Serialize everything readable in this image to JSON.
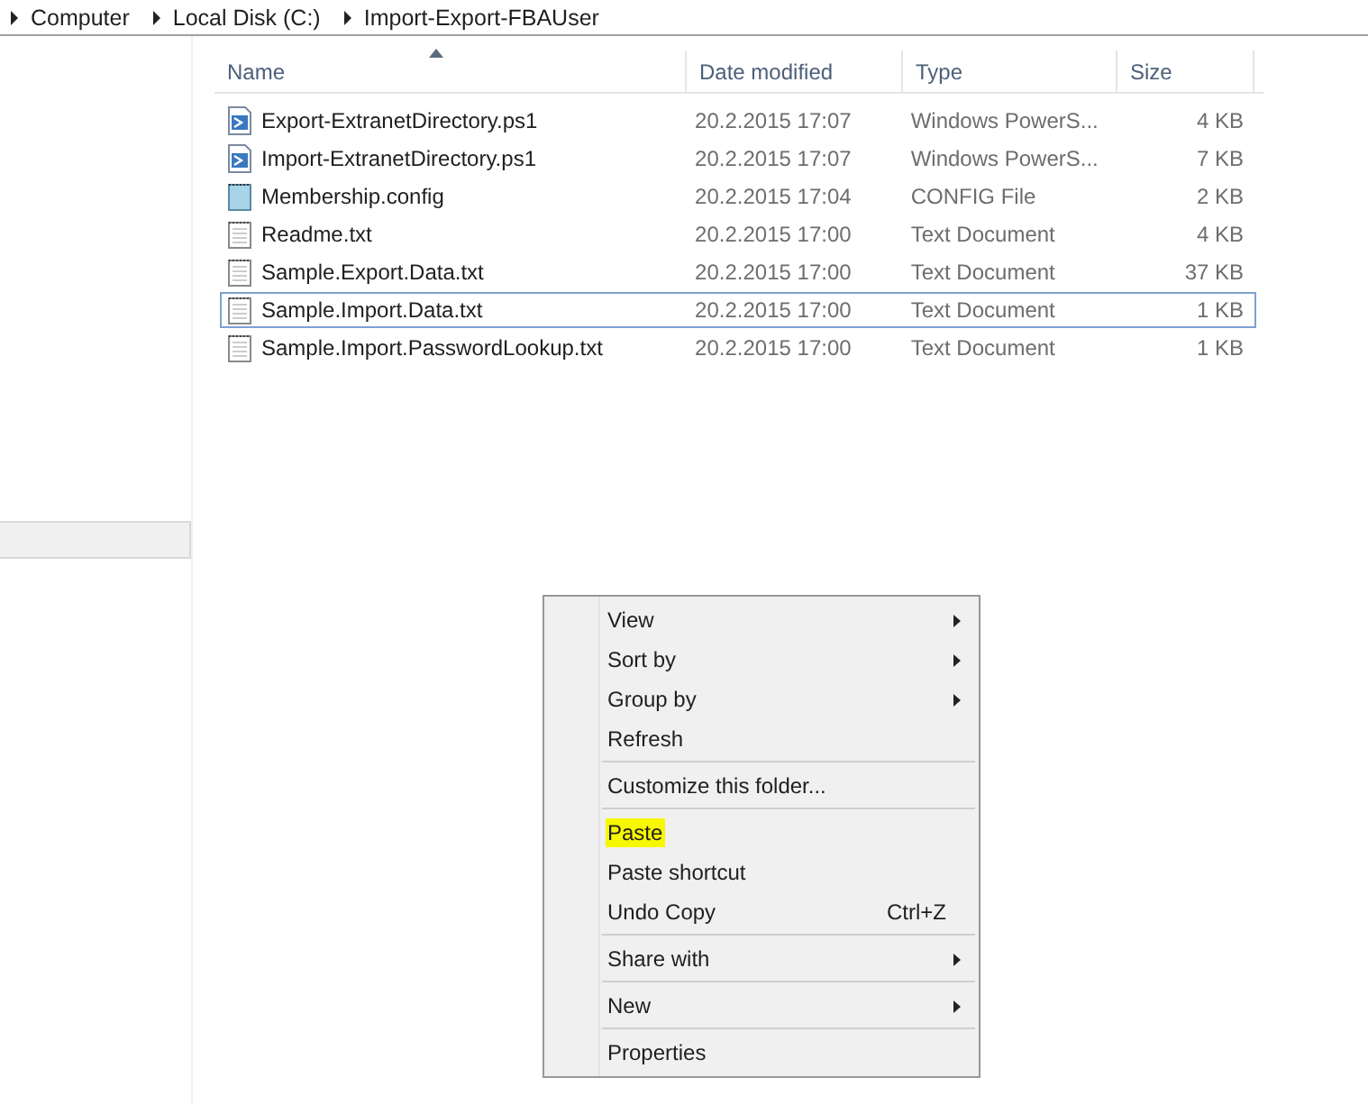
{
  "breadcrumb": [
    "Computer",
    "Local Disk (C:)",
    "Import-Export-FBAUser"
  ],
  "table": {
    "columns": [
      {
        "label": "Name",
        "sorted": true
      },
      {
        "label": "Date modified",
        "sorted": false
      },
      {
        "label": "Type",
        "sorted": false
      },
      {
        "label": "Size",
        "sorted": false
      }
    ],
    "rows": [
      {
        "kind": "script",
        "name": "Export-ExtranetDirectory.ps1",
        "date": "20.2.2015 17:07",
        "type": "Windows PowerS...",
        "size": "4 KB",
        "selected": false
      },
      {
        "kind": "script",
        "name": "Import-ExtranetDirectory.ps1",
        "date": "20.2.2015 17:07",
        "type": "Windows PowerS...",
        "size": "7 KB",
        "selected": false
      },
      {
        "kind": "config",
        "name": "Membership.config",
        "date": "20.2.2015 17:04",
        "type": "CONFIG File",
        "size": "2 KB",
        "selected": false
      },
      {
        "kind": "text",
        "name": "Readme.txt",
        "date": "20.2.2015 17:00",
        "type": "Text Document",
        "size": "4 KB",
        "selected": false
      },
      {
        "kind": "text",
        "name": "Sample.Export.Data.txt",
        "date": "20.2.2015 17:00",
        "type": "Text Document",
        "size": "37 KB",
        "selected": false
      },
      {
        "kind": "text",
        "name": "Sample.Import.Data.txt",
        "date": "20.2.2015 17:00",
        "type": "Text Document",
        "size": "1 KB",
        "selected": true
      },
      {
        "kind": "text",
        "name": "Sample.Import.PasswordLookup.txt",
        "date": "20.2.2015 17:00",
        "type": "Text Document",
        "size": "1 KB",
        "selected": false
      }
    ]
  },
  "context_menu": [
    {
      "kind": "item",
      "label": "View",
      "submenu": true,
      "highlighted": false
    },
    {
      "kind": "item",
      "label": "Sort by",
      "submenu": true,
      "highlighted": false
    },
    {
      "kind": "item",
      "label": "Group by",
      "submenu": true,
      "highlighted": false
    },
    {
      "kind": "item",
      "label": "Refresh",
      "submenu": false,
      "highlighted": false
    },
    {
      "kind": "separator"
    },
    {
      "kind": "item",
      "label": "Customize this folder...",
      "submenu": false,
      "highlighted": false
    },
    {
      "kind": "separator"
    },
    {
      "kind": "item",
      "label": "Paste",
      "submenu": false,
      "highlighted": true
    },
    {
      "kind": "item",
      "label": "Paste shortcut",
      "submenu": false,
      "highlighted": false
    },
    {
      "kind": "item",
      "label": "Undo Copy",
      "shortcut": "Ctrl+Z",
      "submenu": false,
      "highlighted": false
    },
    {
      "kind": "separator"
    },
    {
      "kind": "item",
      "label": "Share with",
      "submenu": true,
      "highlighted": false
    },
    {
      "kind": "separator"
    },
    {
      "kind": "item",
      "label": "New",
      "submenu": true,
      "highlighted": false
    },
    {
      "kind": "separator"
    },
    {
      "kind": "item",
      "label": "Properties",
      "submenu": false,
      "highlighted": false
    }
  ]
}
